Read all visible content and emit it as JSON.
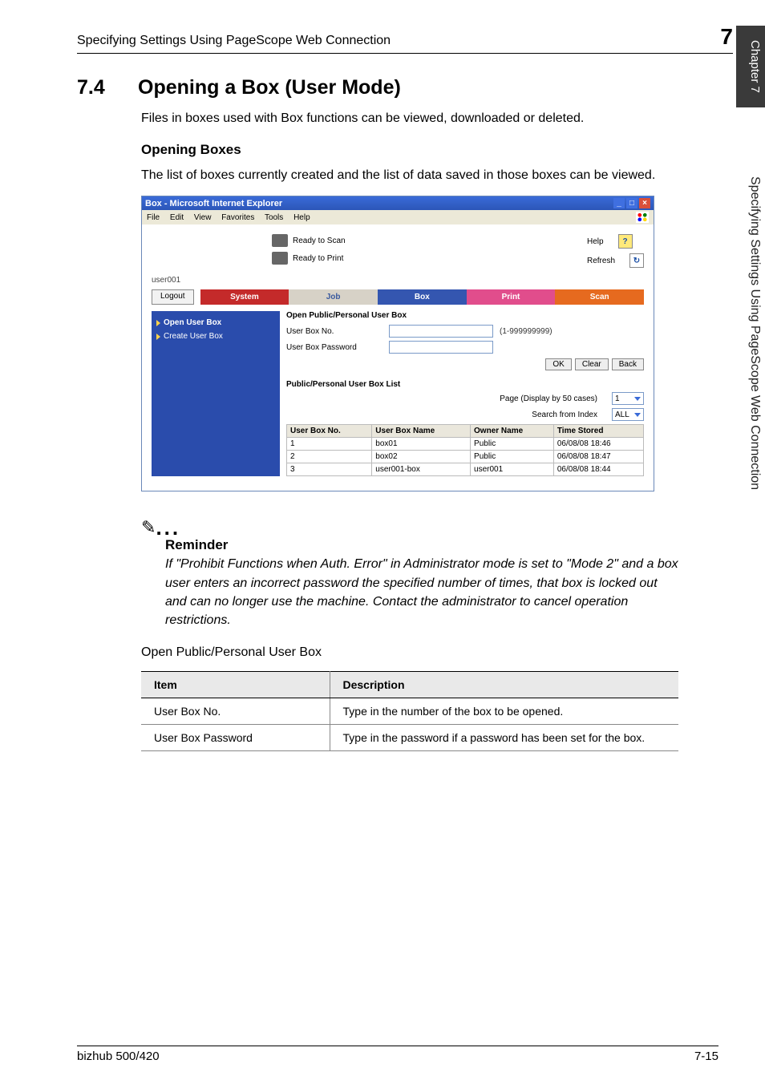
{
  "page": {
    "header_title": "Specifying Settings Using PageScope Web Connection",
    "header_number": "7",
    "chapter_tab": "Chapter 7",
    "side_text": "Specifying Settings Using PageScope Web Connection",
    "section_number": "7.4",
    "section_title": "Opening a Box (User Mode)",
    "intro": "Files in boxes used with Box functions can be viewed, downloaded or deleted.",
    "subhead": "Opening Boxes",
    "subtext": "The list of boxes currently created and the list of data saved in those boxes can be viewed.",
    "footer_left": "bizhub 500/420",
    "footer_right": "7-15"
  },
  "window": {
    "title": "Box - Microsoft Internet Explorer",
    "menus": [
      "File",
      "Edit",
      "View",
      "Favorites",
      "Tools",
      "Help"
    ],
    "status": {
      "scan": "Ready to Scan",
      "print": "Ready to Print"
    },
    "links": {
      "help": "Help",
      "refresh": "Refresh"
    },
    "user": "user001",
    "logout": "Logout",
    "tabs": {
      "system": "System",
      "job": "Job",
      "box": "Box",
      "print": "Print",
      "scan": "Scan"
    },
    "sidebar": {
      "open": "Open User Box",
      "create": "Create User Box"
    },
    "form": {
      "title": "Open Public/Personal User Box",
      "field_no": "User Box No.",
      "range": "(1-999999999)",
      "field_pw": "User Box Password",
      "ok": "OK",
      "clear": "Clear",
      "back": "Back"
    },
    "list": {
      "title": "Public/Personal User Box List",
      "page_label": "Page (Display by 50 cases)",
      "page_value": "1",
      "search_label": "Search from Index",
      "search_value": "ALL",
      "headers": {
        "no": "User Box No.",
        "name": "User Box Name",
        "owner": "Owner Name",
        "time": "Time Stored"
      },
      "rows": [
        {
          "no": "1",
          "name": "box01",
          "owner": "Public",
          "time": "06/08/08 18:46"
        },
        {
          "no": "2",
          "name": "box02",
          "owner": "Public",
          "time": "06/08/08 18:47"
        },
        {
          "no": "3",
          "name": "user001-box",
          "owner": "user001",
          "time": "06/08/08 18:44"
        }
      ]
    }
  },
  "reminder": {
    "head": "Reminder",
    "body": "If \"Prohibit Functions when Auth. Error\" in Administrator mode is set to \"Mode 2\" and a box user enters an incorrect password the specified number of times, that box is locked out and can no longer use the machine. Contact the administrator to cancel operation restrictions."
  },
  "table": {
    "caption": "Open Public/Personal User Box",
    "h1": "Item",
    "h2": "Description",
    "rows": [
      {
        "item": "User Box No.",
        "desc": "Type in the number of the box to be opened."
      },
      {
        "item": "User Box Password",
        "desc": "Type in the password if a password has been set for the box."
      }
    ]
  }
}
